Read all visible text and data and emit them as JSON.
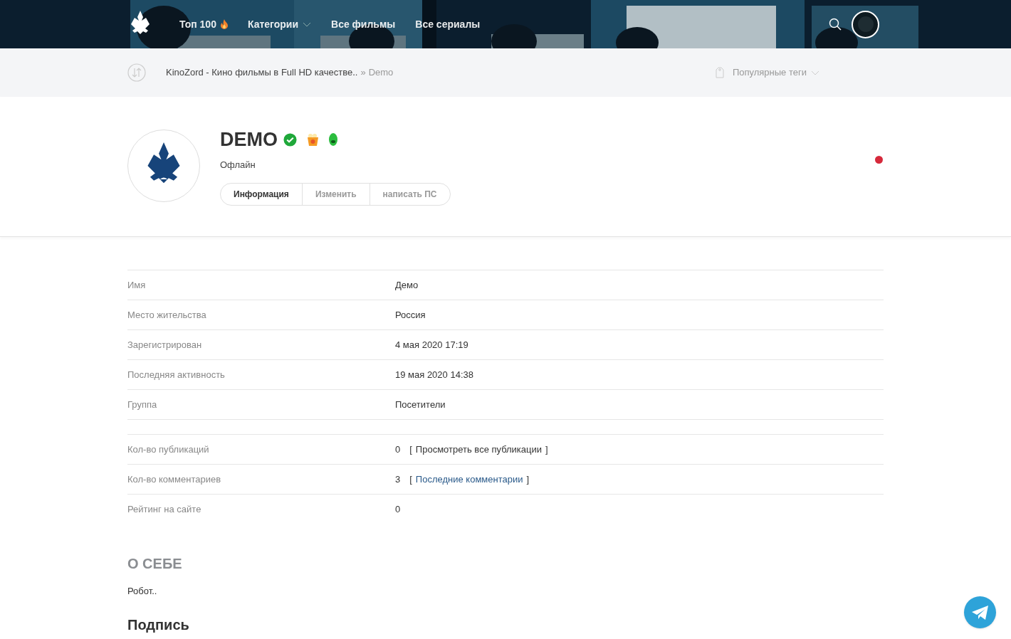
{
  "nav": {
    "items": [
      {
        "label": "Топ 100",
        "kind": "hot"
      },
      {
        "label": "Категории",
        "kind": "dropdown"
      },
      {
        "label": "Все фильмы",
        "kind": "plain"
      },
      {
        "label": "Все сериалы",
        "kind": "plain"
      }
    ]
  },
  "breadcrumb": {
    "site": "KinoZord - Кино фильмы в Full HD качестве..",
    "separator": "»",
    "current": "Demo"
  },
  "tags_menu": {
    "label": "Популярные теги"
  },
  "profile": {
    "name": "DEMO",
    "status": "Офлайн",
    "tabs": [
      {
        "label": "Информация",
        "selected": true
      },
      {
        "label": "Изменить",
        "selected": false
      },
      {
        "label": "написать ПС",
        "selected": false
      }
    ]
  },
  "info_groups": [
    [
      {
        "label": "Имя",
        "value": "Демо"
      },
      {
        "label": "Место жительства",
        "value": "Россия"
      },
      {
        "label": "Зарегистрирован",
        "value": "4 мая 2020 17:19"
      },
      {
        "label": "Последняя активность",
        "value": "19 мая 2020 14:38"
      },
      {
        "label": "Группа",
        "value": "Посетители"
      }
    ],
    [
      {
        "label": "Кол-во публикаций",
        "value": "0",
        "link": {
          "open": "[",
          "text": "Просмотреть все публикации",
          "close": "]",
          "accent": false
        }
      },
      {
        "label": "Кол-во комментариев",
        "value": "3",
        "link": {
          "open": "[",
          "text": "Последние комментарии",
          "close": "]",
          "accent": true
        }
      },
      {
        "label": "Рейтинг на сайте",
        "value": "0"
      }
    ]
  ],
  "about": {
    "title": "О СЕБЕ",
    "text": "Робот.."
  },
  "signature": {
    "title": "Подпись"
  }
}
